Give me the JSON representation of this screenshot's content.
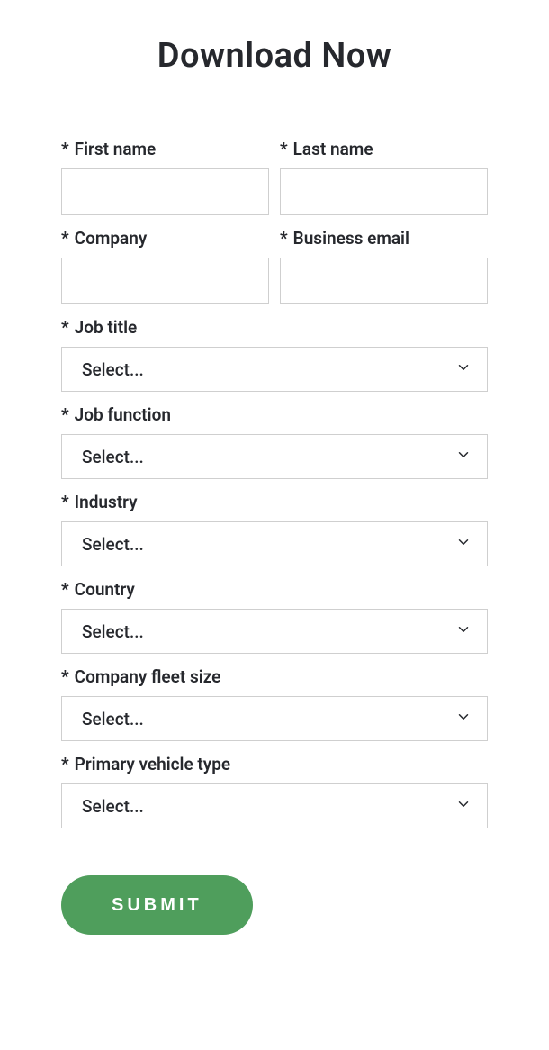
{
  "title": "Download Now",
  "required_marker": "*",
  "fields": {
    "first_name": {
      "label": "First name",
      "value": ""
    },
    "last_name": {
      "label": "Last name",
      "value": ""
    },
    "company": {
      "label": "Company",
      "value": ""
    },
    "email": {
      "label": "Business email",
      "value": ""
    },
    "job_title": {
      "label": "Job title",
      "selected": "Select..."
    },
    "job_function": {
      "label": "Job function",
      "selected": "Select..."
    },
    "industry": {
      "label": "Industry",
      "selected": "Select..."
    },
    "country": {
      "label": "Country",
      "selected": "Select..."
    },
    "fleet_size": {
      "label": "Company fleet size",
      "selected": "Select..."
    },
    "vehicle_type": {
      "label": "Primary vehicle type",
      "selected": "Select..."
    }
  },
  "submit_label": "SUBMIT",
  "colors": {
    "accent": "#4f9e5c",
    "border": "#cfcfcf",
    "text": "#26282d"
  }
}
